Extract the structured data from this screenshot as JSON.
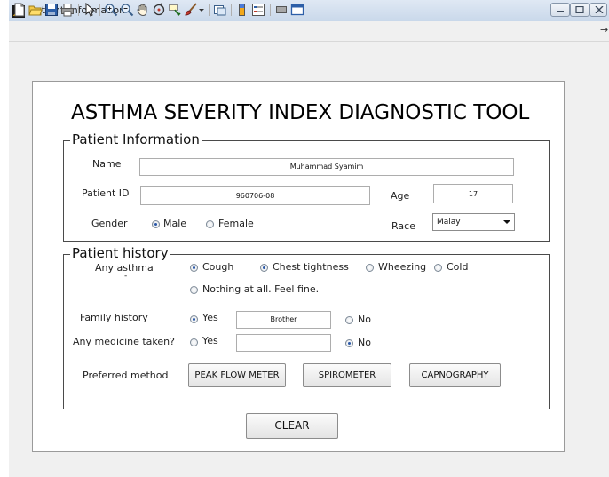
{
  "window": {
    "title": "patient_information"
  },
  "toolbar": {
    "icons": [
      "new-figure",
      "open-file",
      "save",
      "print",
      "edit-plot",
      "zoom-in",
      "zoom-out",
      "pan",
      "rotate-3d",
      "data-cursor",
      "brush",
      "link-plot",
      "colorbar",
      "legend",
      "hide-plot-tools",
      "show-plot-tools"
    ]
  },
  "heading": "ASTHMA SEVERITY INDEX DIAGNOSTIC TOOL",
  "patient_info": {
    "legend": "Patient Information",
    "name_label": "Name",
    "name_value": "Muhammad Syamim",
    "id_label": "Patient ID",
    "id_value": "960706-08",
    "age_label": "Age",
    "age_value": "17",
    "gender_label": "Gender",
    "gender_options": [
      "Male",
      "Female"
    ],
    "gender_selected": "Male",
    "race_label": "Race",
    "race_value": "Malay"
  },
  "patient_history": {
    "legend": "Patient history",
    "asthma_label": "Any asthma",
    "asthma_tick": "-",
    "symptoms": [
      "Cough",
      "Chest tightness",
      "Wheezing",
      "Cold",
      "Nothing at all. Feel fine."
    ],
    "symptoms_selected": [
      "Cough",
      "Chest tightness"
    ],
    "family_label": "Family history",
    "family_yes": "Yes",
    "family_no": "No",
    "family_selected": "Yes",
    "family_value": "Brother",
    "medicine_label": "Any medicine taken?",
    "medicine_yes": "Yes",
    "medicine_no": "No",
    "medicine_selected": "No",
    "medicine_value": "",
    "method_label": "Preferred method",
    "methods": [
      "PEAK FLOW METER",
      "SPIROMETER",
      "CAPNOGRAPHY"
    ]
  },
  "clear_label": "CLEAR",
  "colors": {
    "radio_dot": "#2a58a8",
    "titlebar": "#c9d8ea",
    "figure_bg": "#f0f0f0"
  }
}
